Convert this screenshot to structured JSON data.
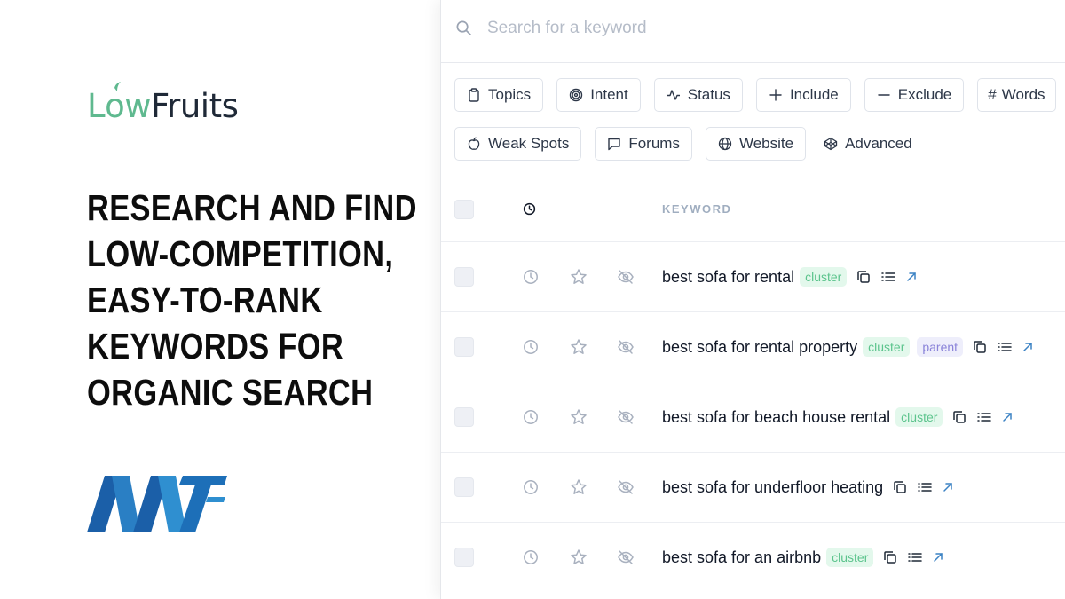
{
  "brand": {
    "name_part1": "L",
    "name_o": "o",
    "name_part2": "w",
    "name_part3": "Fruits"
  },
  "headline": [
    "RESEARCH AND FIND",
    "LOW-COMPETITION,",
    "EASY-TO-RANK",
    "KEYWORDS FOR",
    "ORGANIC SEARCH"
  ],
  "colors": {
    "brand_green": "#5fb98f",
    "logo_blue_dark": "#1b5fa8",
    "logo_blue_light": "#2f8fd0",
    "cluster_bg": "#e3f8ec",
    "cluster_text": "#5cc48d",
    "parent_bg": "#eeeefb",
    "parent_text": "#8a83d9"
  },
  "search": {
    "placeholder": "Search for a keyword",
    "value": ""
  },
  "filters": {
    "row1": [
      {
        "label": "Topics",
        "icon": "clipboard-icon"
      },
      {
        "label": "Intent",
        "icon": "target-icon"
      },
      {
        "label": "Status",
        "icon": "activity-icon"
      },
      {
        "label": "Include",
        "icon": "plus-icon"
      },
      {
        "label": "Exclude",
        "icon": "minus-icon"
      },
      {
        "label": "Words",
        "icon": "hash-icon"
      }
    ],
    "row2": [
      {
        "label": "Weak Spots",
        "icon": "apple-icon"
      },
      {
        "label": "Forums",
        "icon": "message-square-icon"
      },
      {
        "label": "Website",
        "icon": "globe-icon"
      },
      {
        "label": "Advanced",
        "icon": "codepen-icon"
      }
    ]
  },
  "table": {
    "header": {
      "keyword": "KEYWORD"
    },
    "rows": [
      {
        "keyword": "best sofa for rental",
        "tags": [
          "cluster"
        ]
      },
      {
        "keyword": "best sofa for rental property",
        "tags": [
          "cluster",
          "parent"
        ]
      },
      {
        "keyword": "best sofa for beach house rental",
        "tags": [
          "cluster"
        ]
      },
      {
        "keyword": "best sofa for underfloor heating",
        "tags": []
      },
      {
        "keyword": "best sofa for an airbnb",
        "tags": [
          "cluster"
        ]
      }
    ]
  }
}
